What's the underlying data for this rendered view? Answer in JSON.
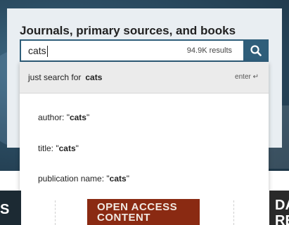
{
  "search": {
    "title": "Journals, primary sources, and books",
    "query": "cats",
    "results_count": "94.9K results",
    "button_icon": "search-icon"
  },
  "dropdown": {
    "top_prefix": "just search for",
    "top_query": "cats",
    "enter_hint": "enter ↵",
    "suggestions": [
      {
        "prefix": "author: \"",
        "term": "cats",
        "suffix": "\""
      },
      {
        "prefix": "title: \"",
        "term": "cats",
        "suffix": "\""
      },
      {
        "prefix": "publication name: \"",
        "term": "cats",
        "suffix": "\""
      }
    ]
  },
  "banners": {
    "left_text": "S",
    "mid_line1": "OPEN ACCESS",
    "mid_line2": "CONTENT",
    "right_line1": "DA",
    "right_line2": "RE"
  },
  "colors": {
    "accent": "#2f5e7a",
    "card_bg": "#e9eef2",
    "banner_red": "#8a2a12"
  }
}
